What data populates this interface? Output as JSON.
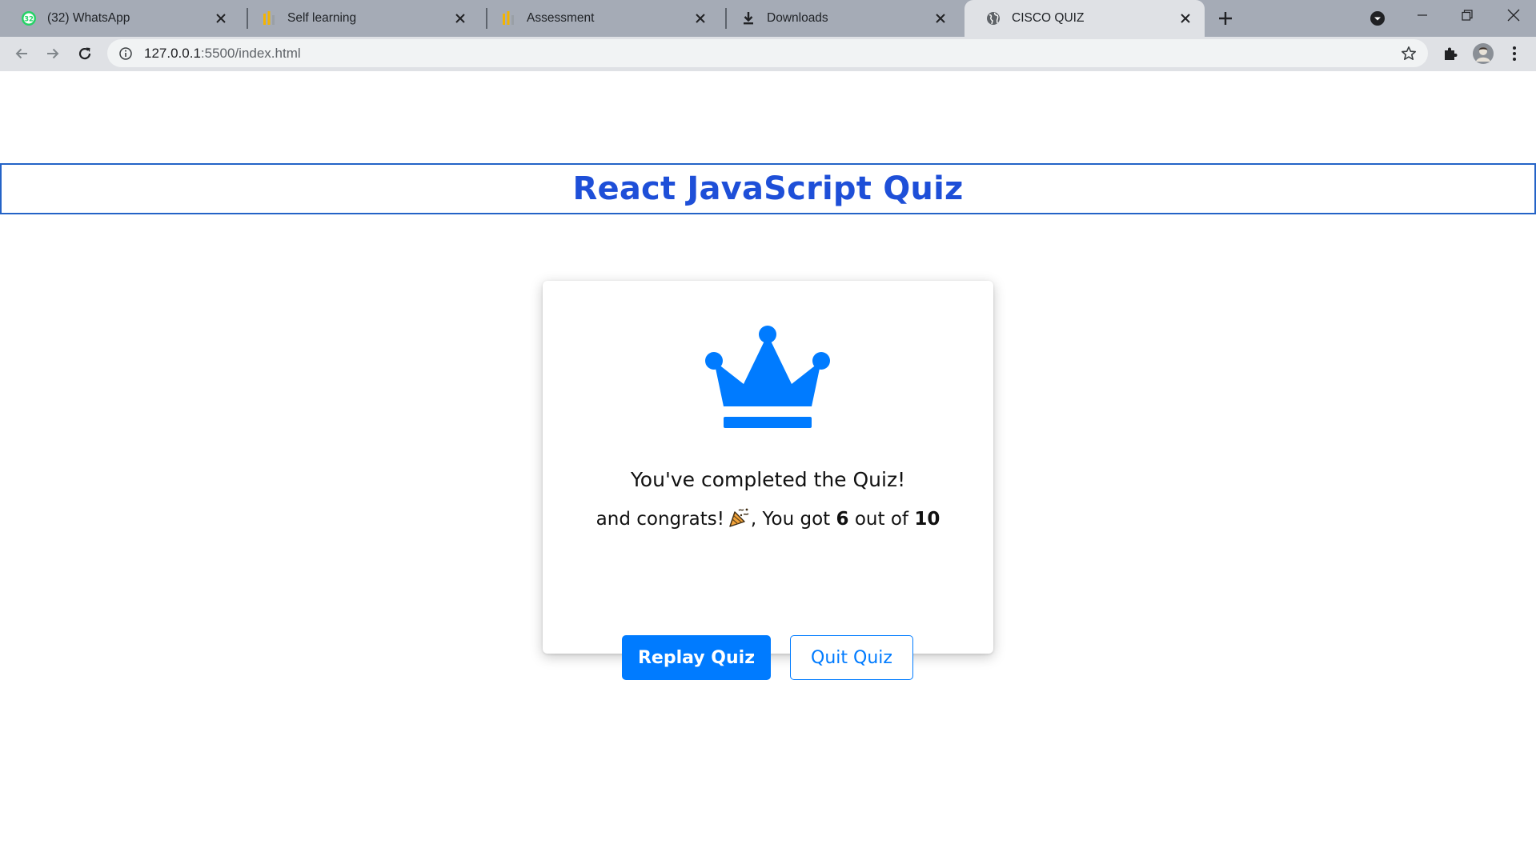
{
  "browser": {
    "tabs": [
      {
        "title": "(32) WhatsApp",
        "icon": "whatsapp-icon",
        "badge": "32",
        "active": false
      },
      {
        "title": "Self learning",
        "icon": "bars-logo-icon",
        "active": false
      },
      {
        "title": "Assessment",
        "icon": "bars-logo-icon",
        "active": false
      },
      {
        "title": "Downloads",
        "icon": "download-icon",
        "active": false
      },
      {
        "title": "CISCO QUIZ",
        "icon": "globe-icon",
        "active": true
      }
    ],
    "address": {
      "host": "127.0.0.1",
      "rest": ":5500/index.html"
    },
    "colors": {
      "tabstrip": "#a5abb6",
      "toolbar": "#dfe1e5"
    }
  },
  "page": {
    "title": "React JavaScript Quiz",
    "result": {
      "icon": "crown-icon",
      "completed_text": "You've completed the Quiz!",
      "congrats_prefix": "and congrats!",
      "congrats_icon": "party-popper-icon",
      "got_text": ", You got",
      "score": "6",
      "out_of_text": "out of",
      "total": "10"
    },
    "buttons": {
      "replay": "Replay Quiz",
      "quit": "Quit Quiz"
    },
    "colors": {
      "accent": "#007bff",
      "title": "#1e4fd8"
    }
  }
}
